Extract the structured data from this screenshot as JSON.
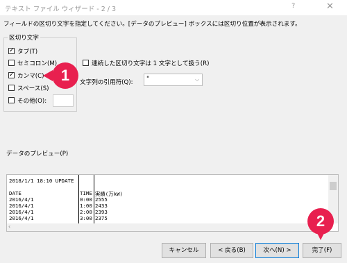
{
  "window": {
    "title": "テキスト ファイル ウィザード - 2 / 3",
    "help_icon": "?",
    "close_icon": "✕"
  },
  "instruction": "フィールドの区切り文字を指定してください。[データのプレビュー] ボックスには区切り位置が表示されます。",
  "delimiters": {
    "group_label": "区切り文字",
    "tab": {
      "label": "タブ(T)",
      "checked": true
    },
    "semicolon": {
      "label": "セミコロン(M)",
      "checked": false
    },
    "comma": {
      "label": "カンマ(C)",
      "checked": true
    },
    "space": {
      "label": "スペース(S)",
      "checked": false
    },
    "other": {
      "label": "その他(O):",
      "checked": false,
      "value": ""
    }
  },
  "consecutive": {
    "label": "連続した区切り文字は 1 文字として扱う(R)",
    "checked": false
  },
  "text_qualifier": {
    "label": "文字列の引用符(Q):",
    "value": "\""
  },
  "preview": {
    "label": "データのプレビュー(P)",
    "rows": [
      [
        "2018/1/1 18:10 UPDATE",
        "",
        ""
      ],
      [
        "",
        "",
        ""
      ],
      [
        "DATE",
        "TIME",
        "実績(万kW)"
      ],
      [
        "2016/4/1",
        "0:00",
        "2555"
      ],
      [
        "2016/4/1",
        "1:00",
        "2433"
      ],
      [
        "2016/4/1",
        "2:00",
        "2393"
      ],
      [
        "2016/4/1",
        "3:00",
        "2375"
      ]
    ]
  },
  "buttons": {
    "cancel": "キャンセル",
    "back": "< 戻る(B)",
    "next": "次へ(N) >",
    "finish": "完了(F)"
  },
  "badges": {
    "one": "1",
    "two": "2"
  },
  "colors": {
    "badge": "#e8204f",
    "default_button_border": "#0078d7"
  }
}
